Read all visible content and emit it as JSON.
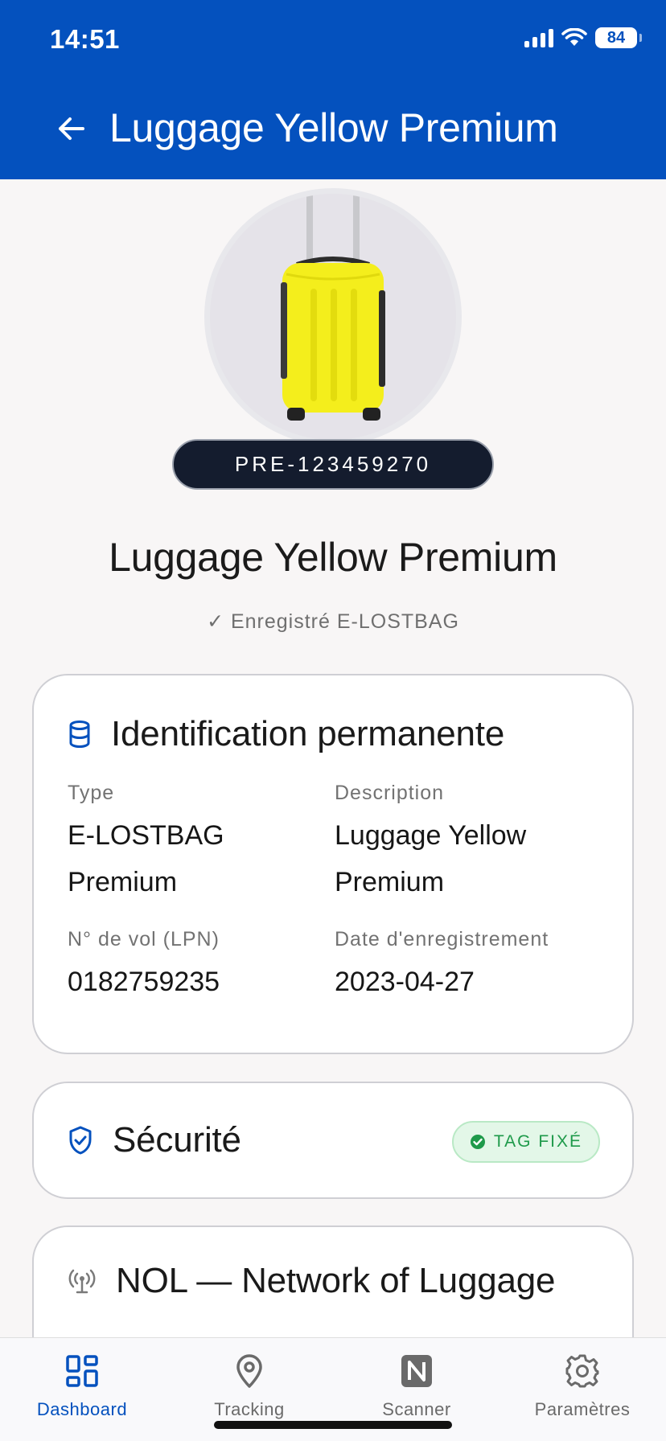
{
  "status_bar": {
    "time": "14:51",
    "battery": "84"
  },
  "header": {
    "title": "Luggage Yellow Premium"
  },
  "luggage": {
    "tag_id": "PRE-123459270",
    "name": "Luggage Yellow Premium",
    "registered_text": "✓ Enregistré E-LOSTBAG"
  },
  "identification": {
    "title": "Identification permanente",
    "type_label": "Type",
    "type_line1": "E-LOSTBAG",
    "type_line2": "Premium",
    "description_label": "Description",
    "description_line1": "Luggage Yellow",
    "description_line2": "Premium",
    "flight_label": "N° de vol (LPN)",
    "flight_value": "0182759235",
    "date_label": "Date d'enregistrement",
    "date_value": "2023-04-27"
  },
  "security": {
    "title": "Sécurité",
    "badge": "TAG FIXÉ"
  },
  "nol": {
    "title": "NOL — Network of Luggage"
  },
  "bottom_nav": {
    "items": [
      {
        "label": "Dashboard",
        "icon": "dashboard-icon",
        "active": true
      },
      {
        "label": "Tracking",
        "icon": "location-pin-icon",
        "active": false
      },
      {
        "label": "Scanner",
        "icon": "nfc-icon",
        "active": false
      },
      {
        "label": "Paramètres",
        "icon": "gear-icon",
        "active": false
      }
    ]
  },
  "colors": {
    "primary": "#0451be",
    "tag_bg": "#141c2e",
    "badge_bg": "#e3f7e8",
    "badge_text": "#1e9a4a",
    "luggage_yellow": "#f4ee1c"
  }
}
